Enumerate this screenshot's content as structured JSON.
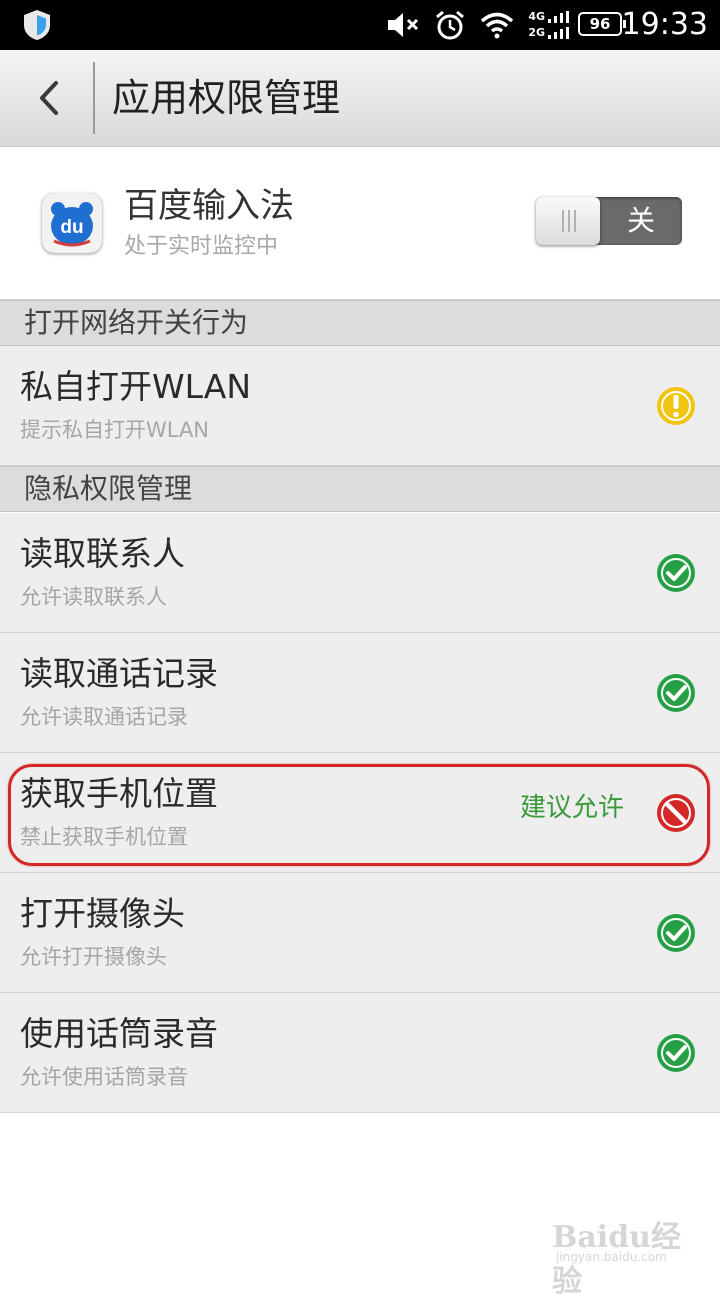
{
  "status_bar": {
    "time": "19:33",
    "battery": "96",
    "net_4g": "4G",
    "net_2g": "2G",
    "icons": [
      "shield-icon",
      "mute-icon",
      "alarm-icon",
      "wifi-icon",
      "signal-icon",
      "battery-icon"
    ]
  },
  "title_bar": {
    "title": "应用权限管理",
    "back_icon": "chevron-left-icon"
  },
  "app": {
    "name": "百度输入法",
    "status": "处于实时监控中",
    "toggle_label": "关",
    "icon_text": "du"
  },
  "sections": [
    {
      "header": "打开网络开关行为",
      "items": [
        {
          "title": "私自打开WLAN",
          "subtitle": "提示私自打开WLAN",
          "icon": "warning-icon",
          "color": "#f1c40f"
        }
      ]
    },
    {
      "header": "隐私权限管理",
      "items": [
        {
          "title": "读取联系人",
          "subtitle": "允许读取联系人",
          "icon": "check-icon",
          "color": "#27a045"
        },
        {
          "title": "读取通话记录",
          "subtitle": "允许读取通话记录",
          "icon": "check-icon",
          "color": "#27a045"
        },
        {
          "title": "获取手机位置",
          "subtitle": "禁止获取手机位置",
          "hint": "建议允许",
          "icon": "forbidden-icon",
          "color": "#d42828"
        },
        {
          "title": "打开摄像头",
          "subtitle": "允许打开摄像头",
          "icon": "check-icon",
          "color": "#27a045"
        },
        {
          "title": "使用话筒录音",
          "subtitle": "允许使用话筒录音",
          "icon": "check-icon",
          "color": "#27a045"
        }
      ]
    }
  ],
  "watermark": {
    "brand": "Baidu经验",
    "url": "jingyan.baidu.com"
  }
}
